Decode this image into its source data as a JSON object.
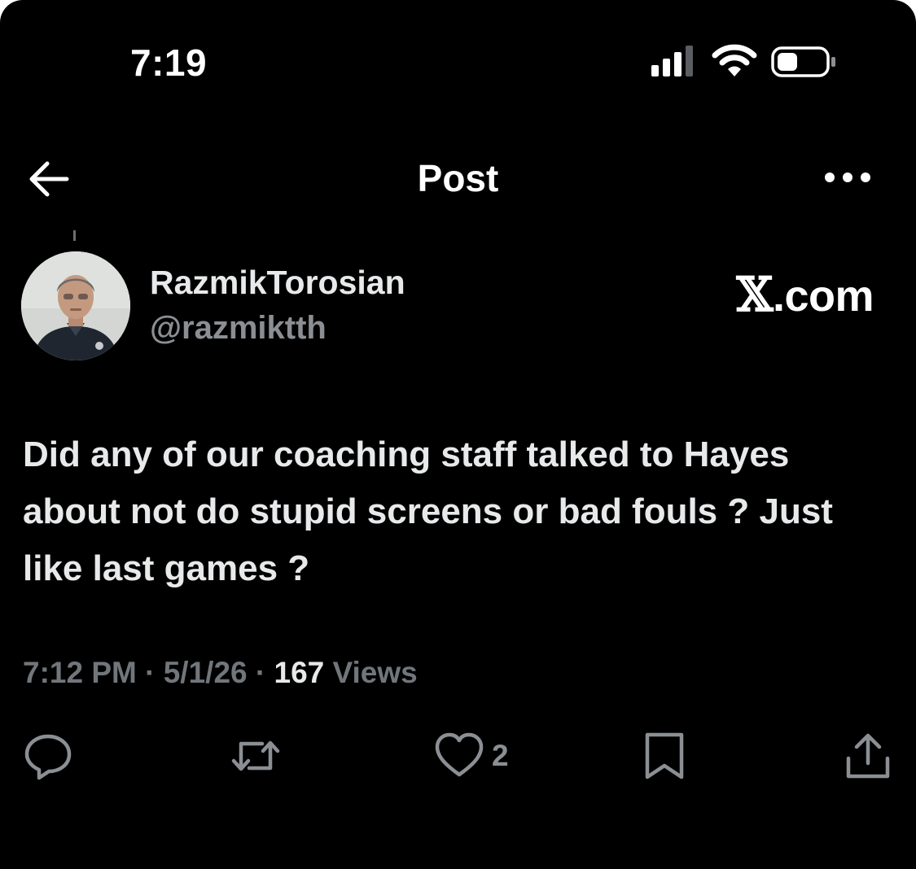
{
  "status_bar": {
    "time": "7:19",
    "icons": [
      "cellular-signal-icon",
      "wifi-icon",
      "battery-icon"
    ]
  },
  "header": {
    "title": "Post",
    "back_icon": "back-arrow-icon",
    "more_icon": "more-options-icon"
  },
  "post": {
    "author": {
      "display_name": "RazmikTorosian",
      "handle": "@razmiktth"
    },
    "brand": {
      "logo_mark": "𝕏",
      "domain": ".com"
    },
    "text": "Did any of our coaching staff talked to Hayes about not do stupid screens or bad fouls ? Just like last games ?",
    "meta": {
      "time": "7:12 PM",
      "separator": "·",
      "date": "5/1/26",
      "views_count": "167",
      "views_label": "Views"
    },
    "actions": {
      "reply_icon": "reply-icon",
      "repost_icon": "repost-icon",
      "like_icon": "heart-icon",
      "like_count": "2",
      "bookmark_icon": "bookmark-icon",
      "share_icon": "share-icon"
    }
  },
  "colors": {
    "background": "#000000",
    "primary_text": "#e7e9ea",
    "secondary_text": "#71767b"
  }
}
